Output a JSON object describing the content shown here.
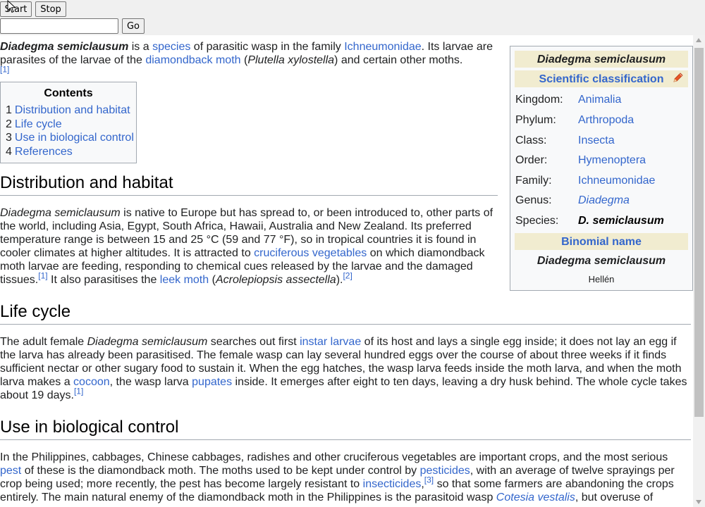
{
  "toolbar": {
    "start_label": "Start",
    "stop_label": "Stop",
    "go_label": "Go",
    "url_value": ""
  },
  "article": {
    "intro": {
      "t1": "Diadegma semiclausum",
      "t2": " is a ",
      "l1": "species",
      "t3": " of parasitic wasp in the family ",
      "l2": "Ichneumonidae",
      "t4": ". Its larvae are parasites of the larvae of the ",
      "l3": "diamondback moth",
      "t5": " (",
      "t6": "Plutella xylostella",
      "t7": ") and certain other moths.",
      "ref": "[1]"
    },
    "toc": {
      "title": "Contents",
      "items": [
        {
          "num": "1",
          "label": "Distribution and habitat"
        },
        {
          "num": "2",
          "label": "Life cycle"
        },
        {
          "num": "3",
          "label": "Use in biological control"
        },
        {
          "num": "4",
          "label": "References"
        }
      ]
    },
    "distribution": {
      "heading": "Distribution and habitat",
      "t1": "Diadegma semiclausum",
      "t2": " is native to Europe but has spread to, or been introduced to, other parts of the world, including Asia, Egypt, South Africa, Hawaii, Australia and New Zealand. Its preferred temperature range is between 15 and 25 °C (59 and 77 °F), so in tropical countries it is found in cooler climates at higher altitudes. It is attracted to ",
      "l1": "cruciferous vegetables",
      "t3": " on which diamondback moth larvae are feeding, responding to chemical cues released by the larvae and the damaged tissues.",
      "ref1": "[1]",
      "t4": " It also parasitises the ",
      "l2": "leek moth",
      "t5": " (",
      "t6": "Acrolepiopsis assectella",
      "t7": ").",
      "ref2": "[2]"
    },
    "lifecycle": {
      "heading": "Life cycle",
      "t1": "The adult female ",
      "t2": "Diadegma semiclausum",
      "t3": " searches out first ",
      "l1": "instar larvae",
      "t4": " of its host and lays a single egg inside; it does not lay an egg if the larva has already been parasitised. The female wasp can lay several hundred eggs over the course of about three weeks if it finds sufficient nectar or other sugary food to sustain it. When the egg hatches, the wasp larva feeds inside the moth larva, and when the moth larva makes a ",
      "l2": "cocoon",
      "t5": ", the wasp larva ",
      "l3": "pupates",
      "t6": " inside. It emerges after eight to ten days, leaving a dry husk behind. The whole cycle takes about 19 days.",
      "ref": "[1]"
    },
    "biocontrol": {
      "heading": "Use in biological control",
      "t1": "In the Philippines, cabbages, Chinese cabbages, radishes and other cruciferous vegetables are important crops, and the most serious ",
      "l1": "pest",
      "t2": " of these is the diamondback moth. The moths used to be kept under control by ",
      "l2": "pesticides",
      "t3": ", with an average of twelve sprayings per crop being used; more recently, the pest has become largely resistant to ",
      "l3": "insecticides",
      "t4": ",",
      "ref": "[3]",
      "t5": " so that some farmers are abandoning the crops entirely. The main natural enemy of the diamondback moth in the Philippines is the parasitoid wasp ",
      "l4": "Cotesia vestalis",
      "t6": ", but overuse of"
    }
  },
  "infobox": {
    "title": "Diadegma semiclausum",
    "classification_header": "Scientific classification",
    "rows": [
      {
        "label": "Kingdom:",
        "value": "Animalia"
      },
      {
        "label": "Phylum:",
        "value": "Arthropoda"
      },
      {
        "label": "Class:",
        "value": "Insecta"
      },
      {
        "label": "Order:",
        "value": "Hymenoptera"
      },
      {
        "label": "Family:",
        "value": "Ichneumonidae"
      },
      {
        "label": "Genus:",
        "value": "Diadegma"
      },
      {
        "label": "Species:",
        "value": "D. semiclausum"
      }
    ],
    "binomial_header": "Binomial name",
    "binomial": "Diadegma semiclausum",
    "authority": "Hellén"
  },
  "colors": {
    "link": "#3366cc",
    "infobox_header": "#f1ecd0",
    "border": "#a2a9b1"
  },
  "icons": [
    "pencil-icon",
    "cursor-icon"
  ]
}
